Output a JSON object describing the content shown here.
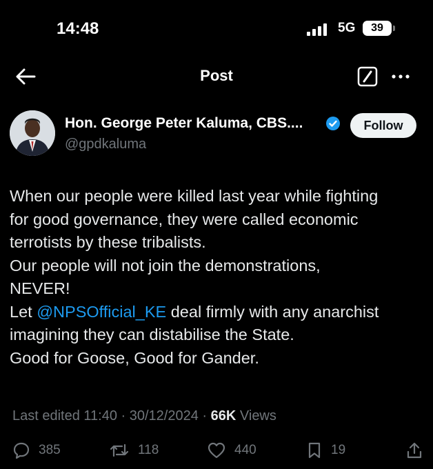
{
  "status_bar": {
    "time": "14:48",
    "network": "5G",
    "battery": "39"
  },
  "nav": {
    "title": "Post"
  },
  "author": {
    "display_name": "Hon. George Peter Kaluma, CBS....",
    "handle": "@gpdkaluma",
    "follow_label": "Follow"
  },
  "tweet": {
    "lines": [
      "When our people were killed last year while fighting",
      "for good governance, they were called economic",
      "terrotists by these tribalists.",
      "Our people will not join the demonstrations,",
      "NEVER!",
      "deal firmly with any anarchist",
      "imagining they can distabilise the State.",
      "Good for Goose, Good for Gander."
    ],
    "line6_prefix": "Let",
    "mention": "@NPSOfficial_KE"
  },
  "meta": {
    "edited": "Last edited 11:40 · 30/12/2024 · ",
    "views_count": "66K",
    "views_label": "Views"
  },
  "actions": {
    "replies": "385",
    "reposts": "118",
    "likes": "440",
    "bookmarks": "19"
  },
  "colors": {
    "background": "#000000",
    "accent": "#1d9bf0",
    "muted": "#71767b",
    "text": "#e7e9ea"
  },
  "icons": [
    "back-arrow-icon",
    "grok-icon",
    "more-icon",
    "verified-icon",
    "reply-icon",
    "repost-icon",
    "like-icon",
    "bookmark-icon",
    "share-icon"
  ]
}
